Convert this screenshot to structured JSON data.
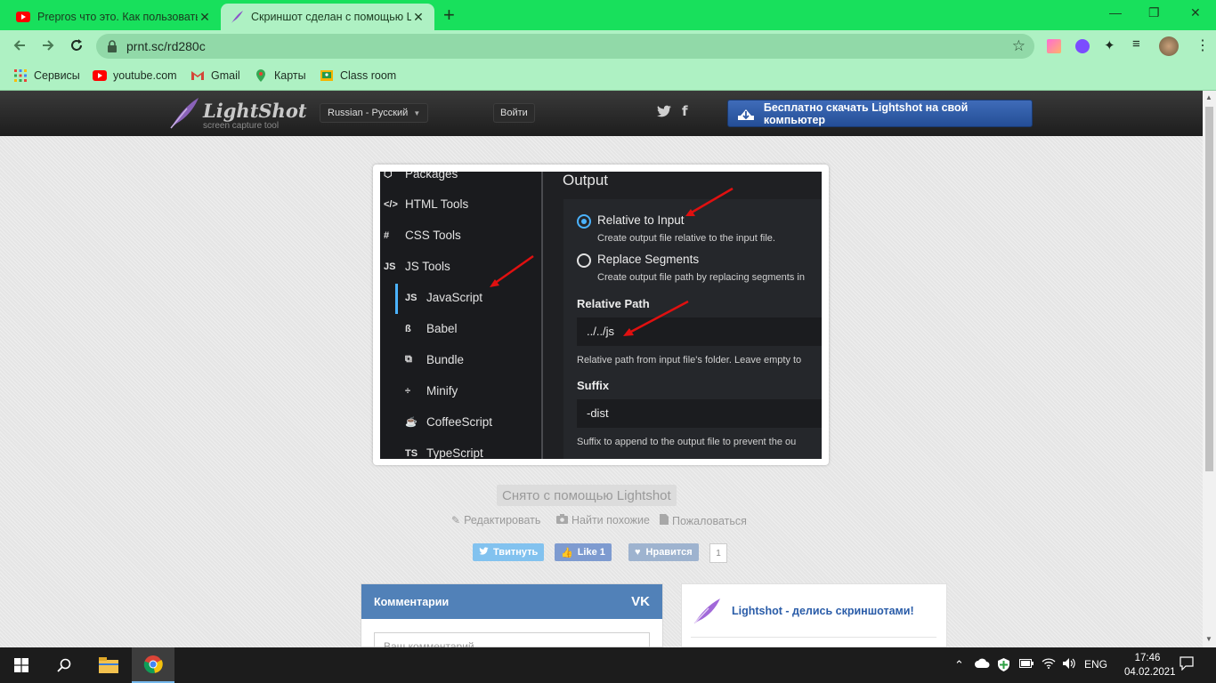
{
  "browser": {
    "tabs": [
      {
        "title": "Prepros что это. Как пользоваться",
        "active": false
      },
      {
        "title": "Скриншот сделан с помощью Lightshot",
        "active": true
      }
    ],
    "new_tab": "+",
    "window_controls": {
      "minimize": "—",
      "maximize": "❐",
      "close": "✕"
    },
    "url": "prnt.sc/rd280c",
    "bookmarks": [
      {
        "label": "Сервисы",
        "icon": "apps-grid-icon"
      },
      {
        "label": "youtube.com",
        "icon": "youtube-icon"
      },
      {
        "label": "Gmail",
        "icon": "gmail-icon"
      },
      {
        "label": "Карты",
        "icon": "maps-icon"
      },
      {
        "label": "Class room",
        "icon": "classroom-icon"
      }
    ]
  },
  "lightshot": {
    "logo_name": "LightShot",
    "logo_tagline": "screen capture tool",
    "language": "Russian - Русский",
    "login": "Войти",
    "twitter": "twitter-icon",
    "facebook": "f",
    "download": "Бесплатно скачать Lightshot на свой компьютер",
    "credit": "Снято с помощью Lightshot",
    "actions": {
      "edit": "Редактировать",
      "similar": "Найти похожие",
      "report": "Пожаловаться"
    },
    "share": {
      "tweet": "Твитнуть",
      "like": "Like 1",
      "vk_like": "Нравится",
      "vk_count": "1"
    },
    "comments_title": "Комментарии",
    "comments_placeholder": "Ваш комментарий...",
    "promo_title": "Lightshot - делись скриншотами!",
    "colors": {
      "header": "#1d1d1d",
      "download_button": "#2f5ba6",
      "vk": "#5181b8",
      "twitter": "#55acee",
      "facebook": "#4267b2"
    }
  },
  "screenshot": {
    "sidebar": [
      {
        "icon": "⬡",
        "label": "Packages"
      },
      {
        "icon": "</>",
        "label": "HTML Tools"
      },
      {
        "icon": "#",
        "label": "CSS Tools"
      },
      {
        "icon": "JS",
        "label": "JS Tools"
      },
      {
        "icon": "JS",
        "label": "JavaScript"
      },
      {
        "icon": "ß",
        "label": "Babel"
      },
      {
        "icon": "⧉",
        "label": "Bundle"
      },
      {
        "icon": "÷",
        "label": "Minify"
      },
      {
        "icon": "☕",
        "label": "CoffeeScript"
      },
      {
        "icon": "TS",
        "label": "TypeScript"
      }
    ],
    "heading": "Output",
    "option1_label": "Relative to Input",
    "option1_desc": "Create output file relative to the input file.",
    "option2_label": "Replace Segments",
    "option2_desc": "Create output file path by replacing segments in",
    "relative_path_label": "Relative Path",
    "relative_path_value": "../../js",
    "relative_path_desc": "Relative path from input file's folder. Leave empty to",
    "suffix_label": "Suffix",
    "suffix_value": "-dist",
    "suffix_desc": "Suffix to append to the output file to prevent the ou"
  },
  "taskbar": {
    "language": "ENG",
    "time": "17:46",
    "date": "04.02.2021"
  }
}
